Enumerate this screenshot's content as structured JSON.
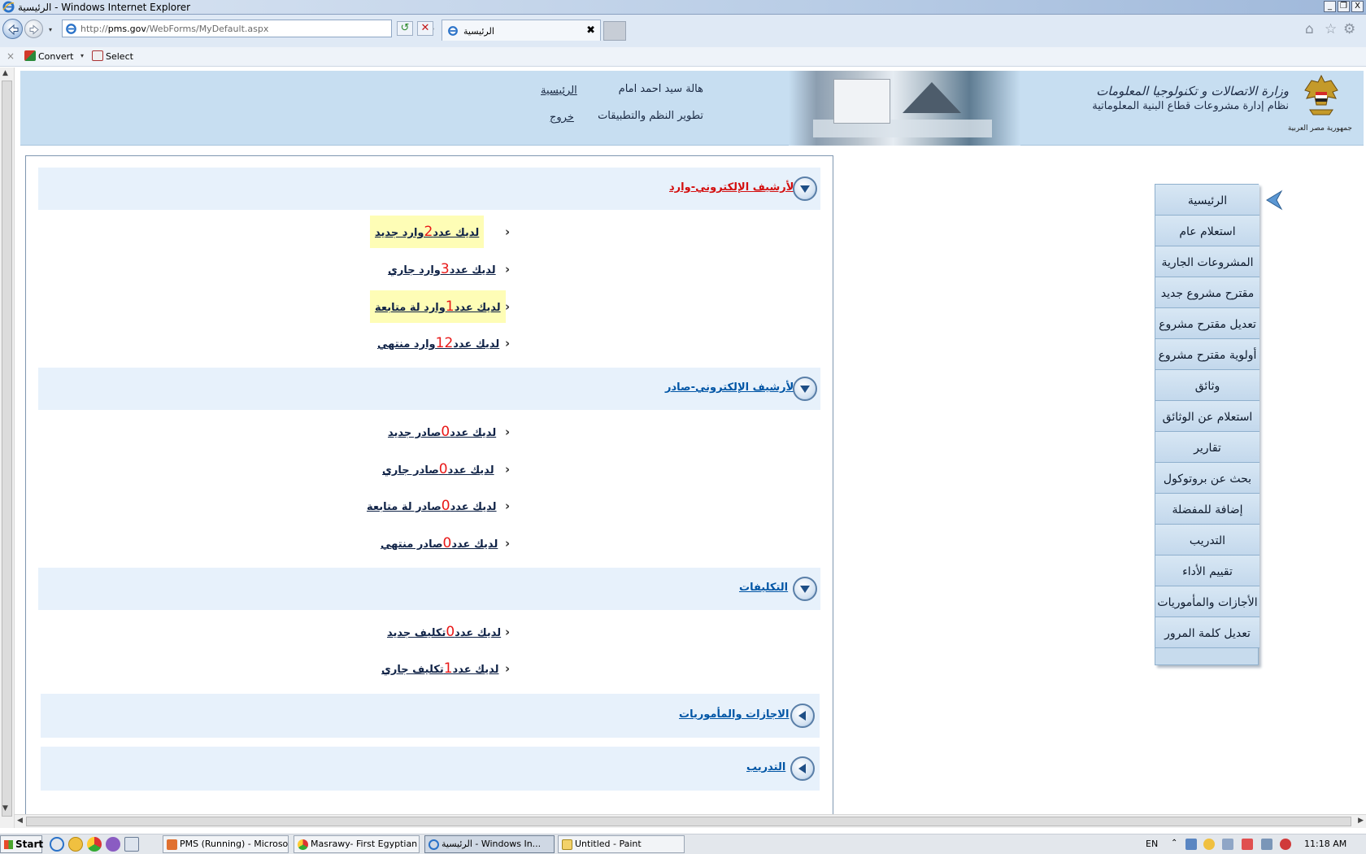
{
  "window": {
    "title": "الرئيسية - Windows Internet Explorer",
    "minimize": "_",
    "restore": "❐",
    "close": "X"
  },
  "browser": {
    "address": "http://pms.gov/WebForms/MyDefault.aspx",
    "address_host": "pms.gov",
    "address_prefix": "http://",
    "address_path": "/WebForms/MyDefault.aspx",
    "tab_label": "الرئيسية",
    "tab_close": "✖",
    "refresh": "↺",
    "stop": "✕",
    "home_icon": "⌂",
    "favorites_icon": "☆",
    "tools_icon": "⚙",
    "search_icon": "⌕",
    "dropdown": "▾"
  },
  "commandbar": {
    "close": "×",
    "convert_label": "Convert",
    "select_label": "Select",
    "dropdown": "▾"
  },
  "header": {
    "ministry_line1": "وزارة الاتصالات و تكنولوجيا المعلومات",
    "ministry_line2": "نظام إدارة مشروعات قطاع البنية المعلوماتية",
    "republic_label": "جمهورية مصر العربية",
    "user_name": "هالة سيد احمد امام",
    "department": "تطوير النظم والتطبيقات",
    "home_link": "الرئيسية",
    "logout_link": "خروج"
  },
  "menu": {
    "items": [
      {
        "label": "الرئيسية"
      },
      {
        "label": "استعلام عام"
      },
      {
        "label": "المشروعات الجارية"
      },
      {
        "label": "مقترح مشروع جديد"
      },
      {
        "label": "تعديل مقترح مشروع"
      },
      {
        "label": "أولوية مقترح مشروع"
      },
      {
        "label": "وثائق"
      },
      {
        "label": "استعلام عن الوثائق"
      },
      {
        "label": "تقارير"
      },
      {
        "label": "بحث عن بروتوكول"
      },
      {
        "label": "إضافة للمفضلة"
      },
      {
        "label": "التدريب"
      },
      {
        "label": "تقييم الأداء"
      },
      {
        "label": "الأجازات والمأموريات"
      },
      {
        "label": "تعديل كلمة المرور"
      }
    ]
  },
  "sections": {
    "incoming": {
      "title": "الأرشيف الإلكتروني-وارد",
      "rows": [
        {
          "prefix": "لديك عدد",
          "count": "2",
          "suffix": "وارد جديد",
          "highlight": true
        },
        {
          "prefix": "لديك عدد",
          "count": "3",
          "suffix": "وارد جاري",
          "highlight": false
        },
        {
          "prefix": "لديك عدد",
          "count": "1",
          "suffix": "وارد لة متابعة",
          "highlight": true
        },
        {
          "prefix": "لديك عدد",
          "count": "12",
          "suffix": "وارد منتهي",
          "highlight": false
        }
      ]
    },
    "outgoing": {
      "title": "الأرشيف الإلكتروني-صادر",
      "rows": [
        {
          "prefix": "لديك عدد",
          "count": "0",
          "suffix": "صادر جديد"
        },
        {
          "prefix": "لديك عدد",
          "count": "0",
          "suffix": "صادر جاري"
        },
        {
          "prefix": "لديك عدد",
          "count": "0",
          "suffix": "صادر لة متابعة"
        },
        {
          "prefix": "لديك عدد",
          "count": "0",
          "suffix": "صادر منتهي"
        }
      ]
    },
    "assignments": {
      "title": "التكليفات",
      "rows": [
        {
          "prefix": "لديك عدد",
          "count": "0",
          "suffix": "تكليف جديد"
        },
        {
          "prefix": "لديك عدد",
          "count": "1",
          "suffix": "تكليف جاري"
        }
      ]
    },
    "leaves": {
      "title": "الاجازات والمأموريات"
    },
    "training": {
      "title": "التدريب"
    }
  },
  "taskbar": {
    "start_label": "Start",
    "tasks": [
      {
        "label": "PMS (Running) - Microsof..."
      },
      {
        "label": "Masrawy- First Egyptian ..."
      },
      {
        "label": "الرئيسية - Windows In..."
      },
      {
        "label": "Untitled - Paint"
      }
    ],
    "language": "EN",
    "time": "11:18 AM"
  },
  "colors": {
    "header_bg": "#c7def1",
    "menu_bg": "#c7dbed",
    "section_header_bg": "#e7f1fb",
    "highlight_yellow": "#fefdb6",
    "count_red": "#e81818",
    "title_red": "#d30f0f",
    "link_blue": "#0055a5"
  }
}
